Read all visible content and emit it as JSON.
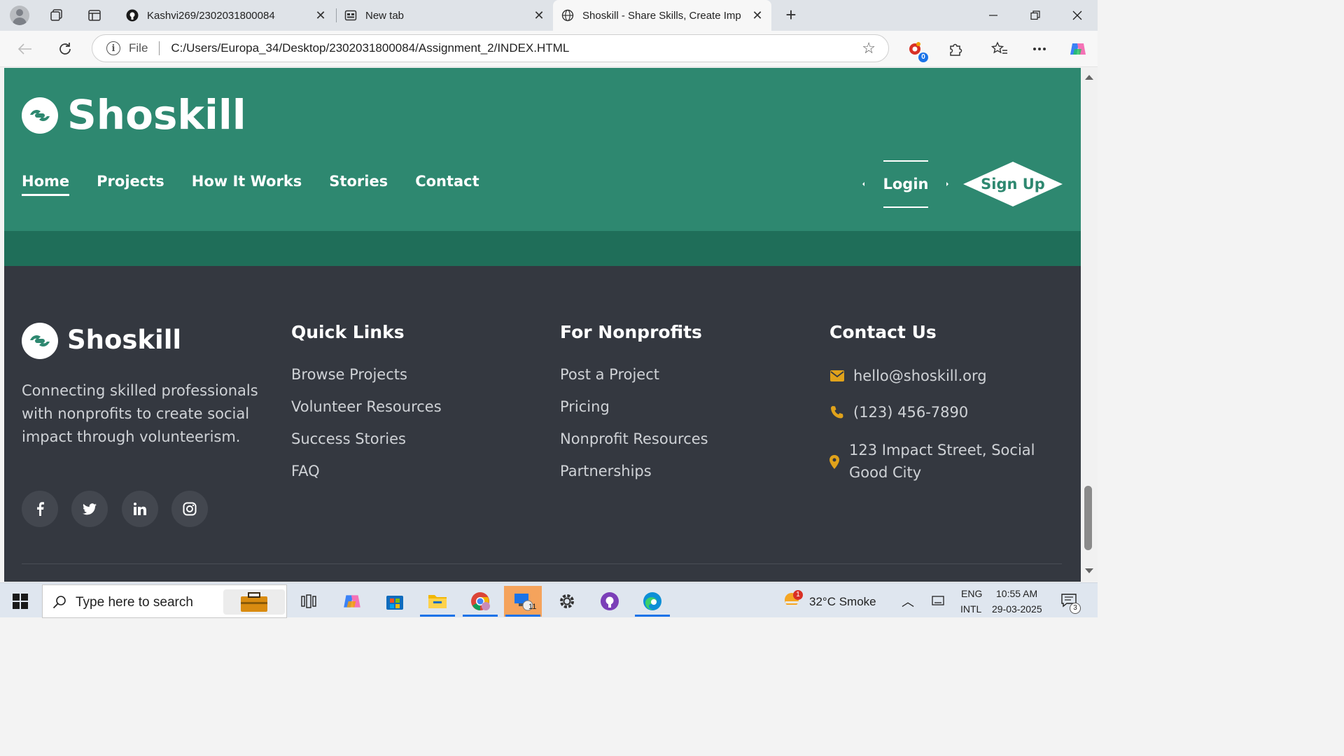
{
  "browser": {
    "tabs": [
      {
        "title": "Kashvi269/2302031800084",
        "icon": "github-icon"
      },
      {
        "title": "New tab",
        "icon": "newtab-icon"
      },
      {
        "title": "Shoskill - Share Skills, Create Imp",
        "icon": "globe-icon"
      }
    ],
    "address": {
      "scheme_label": "File",
      "url": "C:/Users/Europa_34/Desktop/2302031800084/Assignment_2/INDEX.HTML"
    },
    "extension_badge": "0"
  },
  "site": {
    "brand": "Shoskill",
    "nav": [
      {
        "label": "Home"
      },
      {
        "label": "Projects"
      },
      {
        "label": "How It Works"
      },
      {
        "label": "Stories"
      },
      {
        "label": "Contact"
      }
    ],
    "login_label": "Login",
    "signup_label": "Sign Up",
    "colors": {
      "primary": "#2e8870",
      "footer_bg": "#343840",
      "accent": "#e0a21b"
    }
  },
  "footer": {
    "brand": "Shoskill",
    "description": "Connecting skilled professionals with nonprofits to create social impact through volunteerism.",
    "social": [
      "facebook-icon",
      "twitter-icon",
      "linkedin-icon",
      "instagram-icon"
    ],
    "quick_links": {
      "title": "Quick Links",
      "items": [
        "Browse Projects",
        "Volunteer Resources",
        "Success Stories",
        "FAQ"
      ]
    },
    "nonprofits": {
      "title": "For Nonprofits",
      "items": [
        "Post a Project",
        "Pricing",
        "Nonprofit Resources",
        "Partnerships"
      ]
    },
    "contact": {
      "title": "Contact Us",
      "email": "hello@shoskill.org",
      "phone": "(123) 456-7890",
      "address": "123 Impact Street, Social Good City"
    }
  },
  "taskbar": {
    "search_placeholder": "Type here to search",
    "weather": "32°C  Smoke",
    "weather_badge": "1",
    "language_top": "ENG",
    "language_bottom": "INTL",
    "time": "10:55 AM",
    "date": "29-03-2025",
    "notifications": "3",
    "app_badge": "11"
  }
}
